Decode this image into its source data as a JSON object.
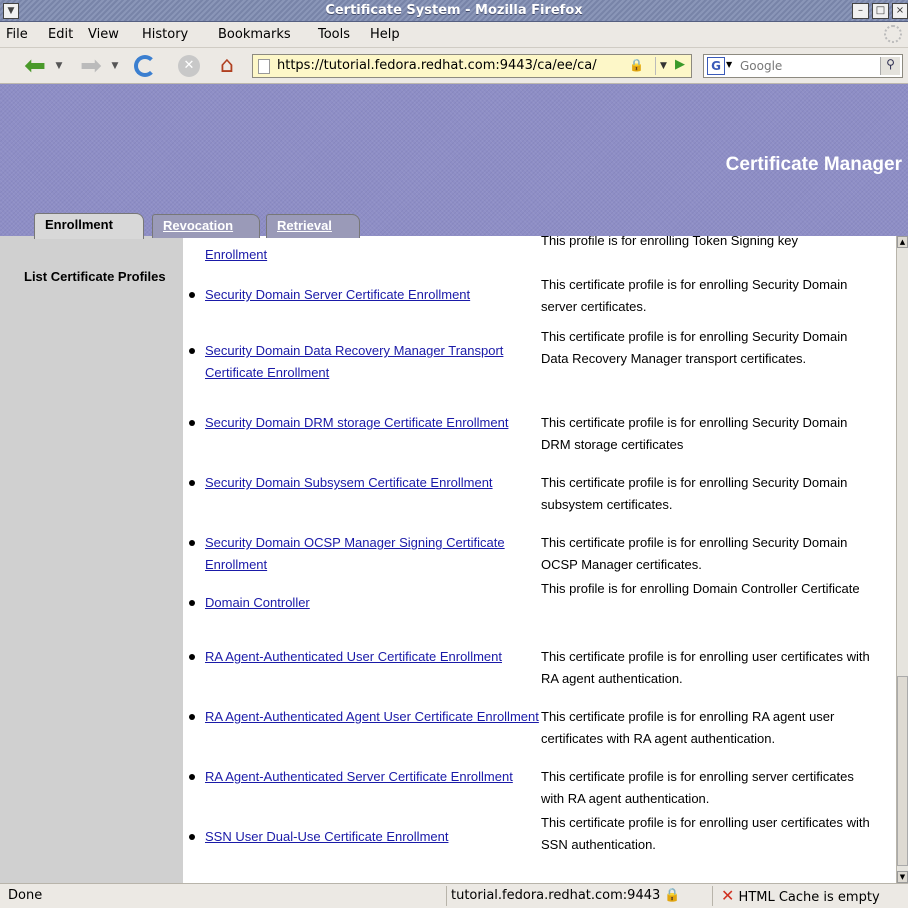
{
  "window": {
    "title": "Certificate System - Mozilla Firefox"
  },
  "menu": [
    "File",
    "Edit",
    "View",
    "History",
    "Bookmarks",
    "Tools",
    "Help"
  ],
  "nav": {
    "url": "https://tutorial.fedora.redhat.com:9443/ca/ee/ca/",
    "search_placeholder": "Google"
  },
  "banner": {
    "app_title": "Certificate Manager"
  },
  "tabs": {
    "enrollment": "Enrollment",
    "revocation": "Revocation",
    "retrieval": "Retrieval"
  },
  "sidebar": {
    "link": "List Certificate Profiles"
  },
  "profiles": [
    {
      "name": "Enrollment",
      "desc": "This profile is for enrolling Token Signing key"
    },
    {
      "name": "Security Domain Server Certificate Enrollment",
      "desc": "This certificate profile is for enrolling Security Domain server certificates."
    },
    {
      "name": "Security Domain Data Recovery Manager Transport Certificate Enrollment",
      "desc": "This certificate profile is for enrolling Security Domain Data Recovery Manager transport certificates."
    },
    {
      "name": "Security Domain DRM storage Certificate Enrollment",
      "desc": "This certificate profile is for enrolling Security Domain DRM storage certificates"
    },
    {
      "name": "Security Domain Subsysem Certificate Enrollment",
      "desc": "This certificate profile is for enrolling Security Domain subsystem certificates."
    },
    {
      "name": "Security Domain OCSP Manager Signing Certificate Enrollment",
      "desc": "This certificate profile is for enrolling Security Domain OCSP Manager certificates."
    },
    {
      "name": "Domain Controller",
      "desc": "This profile is for enrolling Domain Controller Certificate"
    },
    {
      "name": "RA Agent-Authenticated User Certificate Enrollment",
      "desc": "This certificate profile is for enrolling user certificates with RA agent authentication."
    },
    {
      "name": "RA Agent-Authenticated Agent User Certificate Enrollment",
      "desc": "This certificate profile is for enrolling RA agent user certificates with RA agent authentication."
    },
    {
      "name": "RA Agent-Authenticated Server Certificate Enrollment",
      "desc": "This certificate profile is for enrolling server certificates with RA agent authentication."
    },
    {
      "name": "SSN User Dual-Use Certificate Enrollment",
      "desc": "This certificate profile is for enrolling user certificates with SSN authentication."
    }
  ],
  "status": {
    "text": "Done",
    "host": "tutorial.fedora.redhat.com:9443",
    "cache": "HTML Cache is empty"
  }
}
